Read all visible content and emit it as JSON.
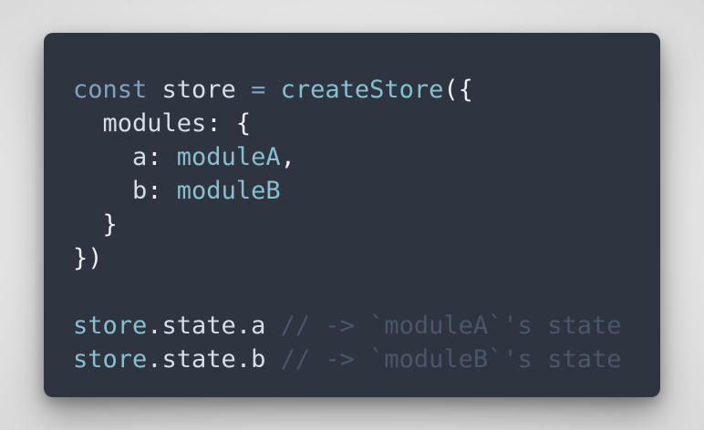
{
  "code_snippet": {
    "lines": [
      [
        {
          "text": "const",
          "kind": "kw"
        },
        {
          "text": " store ",
          "kind": "id"
        },
        {
          "text": "=",
          "kind": "op"
        },
        {
          "text": " ",
          "kind": "id"
        },
        {
          "text": "createStore",
          "kind": "fn"
        },
        {
          "text": "({",
          "kind": "pn"
        }
      ],
      [
        {
          "text": "  modules",
          "kind": "id"
        },
        {
          "text": ": {",
          "kind": "pn"
        }
      ],
      [
        {
          "text": "    a",
          "kind": "id"
        },
        {
          "text": ": ",
          "kind": "pn"
        },
        {
          "text": "moduleA",
          "kind": "fn"
        },
        {
          "text": ",",
          "kind": "pn"
        }
      ],
      [
        {
          "text": "    b",
          "kind": "id"
        },
        {
          "text": ": ",
          "kind": "pn"
        },
        {
          "text": "moduleB",
          "kind": "fn"
        }
      ],
      [
        {
          "text": "  }",
          "kind": "pn"
        }
      ],
      [
        {
          "text": "})",
          "kind": "pn"
        }
      ],
      [],
      [
        {
          "text": "store",
          "kind": "fn"
        },
        {
          "text": ".state.a ",
          "kind": "id"
        },
        {
          "text": "// -> `moduleA`'s state",
          "kind": "cm"
        }
      ],
      [
        {
          "text": "store",
          "kind": "fn"
        },
        {
          "text": ".state.b ",
          "kind": "id"
        },
        {
          "text": "// -> `moduleB`'s state",
          "kind": "cm"
        }
      ]
    ]
  },
  "colors": {
    "background": "#2e3440",
    "keyword": "#81a1c1",
    "function": "#88c0d0",
    "identifier": "#d8dee9",
    "comment": "#4c566a"
  }
}
